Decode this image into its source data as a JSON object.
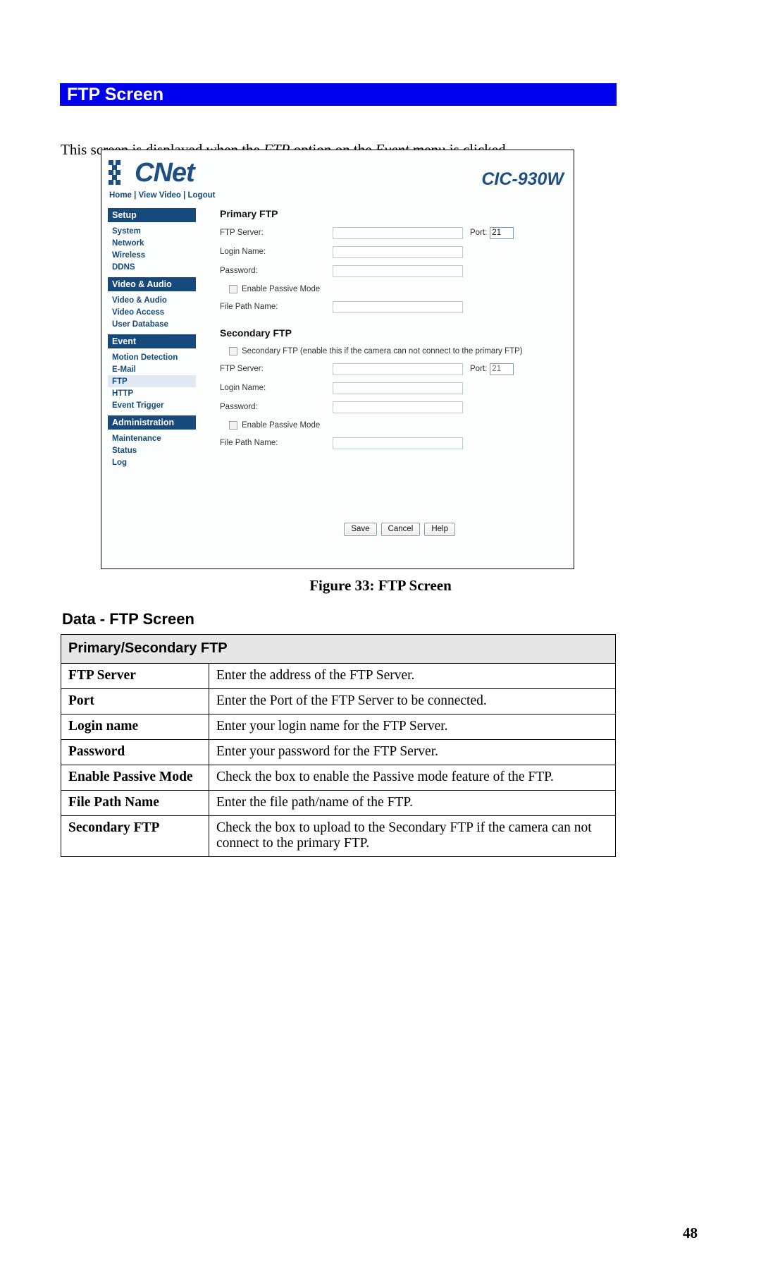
{
  "section": {
    "title": "FTP Screen",
    "bar_color": "#0000ee"
  },
  "intro": {
    "part1": "This screen is displayed when the ",
    "em1": "FTP",
    "part2": " option on the ",
    "em2": "Event",
    "part3": " menu is clicked."
  },
  "screenshot": {
    "logo_text": "CNet",
    "model": "CIC-930W",
    "toplinks": {
      "home": "Home",
      "sep1": "|",
      "view_video": "View Video",
      "sep2": "|",
      "logout": "Logout"
    },
    "sidebar": {
      "groups": [
        {
          "heading": "Setup",
          "items": [
            "System",
            "Network",
            "Wireless",
            "DDNS"
          ]
        },
        {
          "heading": "Video & Audio",
          "items": [
            "Video & Audio",
            "Video Access",
            "User Database"
          ]
        },
        {
          "heading": "Event",
          "items": [
            "Motion Detection",
            "E-Mail",
            "FTP",
            "HTTP",
            "Event Trigger"
          ]
        },
        {
          "heading": "Administration",
          "items": [
            "Maintenance",
            "Status",
            "Log"
          ]
        }
      ],
      "active_item": "FTP"
    },
    "primary": {
      "title": "Primary FTP",
      "ftp_server_label": "FTP Server:",
      "ftp_server_value": "",
      "port_label": "Port:",
      "port_value": "21",
      "login_label": "Login Name:",
      "login_value": "",
      "password_label": "Password:",
      "password_value": "",
      "passive_label": "Enable Passive Mode",
      "passive_checked": false,
      "filepath_label": "File Path Name:",
      "filepath_value": ""
    },
    "secondary": {
      "title": "Secondary FTP",
      "enable_label": "Secondary FTP (enable this if the camera can not connect to the primary FTP)",
      "enable_checked": false,
      "ftp_server_label": "FTP Server:",
      "ftp_server_value": "",
      "port_label": "Port:",
      "port_value": "21",
      "login_label": "Login Name:",
      "login_value": "",
      "password_label": "Password:",
      "password_value": "",
      "passive_label": "Enable Passive Mode",
      "passive_checked": false,
      "filepath_label": "File Path Name:",
      "filepath_value": ""
    },
    "buttons": {
      "save": "Save",
      "cancel": "Cancel",
      "help": "Help"
    }
  },
  "figure_caption": "Figure 33: FTP Screen",
  "data_section": {
    "heading": "Data - FTP Screen",
    "table_header": "Primary/Secondary FTP",
    "rows": [
      {
        "key": "FTP Server",
        "desc": "Enter the address of the FTP Server."
      },
      {
        "key": "Port",
        "desc": "Enter the Port of the FTP Server to be connected."
      },
      {
        "key": "Login name",
        "desc": "Enter your login name for the FTP Server."
      },
      {
        "key": "Password",
        "desc": "Enter your password for the FTP Server."
      },
      {
        "key": "Enable Passive Mode",
        "desc": "Check the box to enable the Passive mode feature of the FTP."
      },
      {
        "key": "File Path Name",
        "desc": "Enter the file path/name of the FTP."
      },
      {
        "key": "Secondary FTP",
        "desc": "Check the box to upload to the Secondary FTP if the camera can not connect to the primary FTP."
      }
    ]
  },
  "page_number": "48"
}
